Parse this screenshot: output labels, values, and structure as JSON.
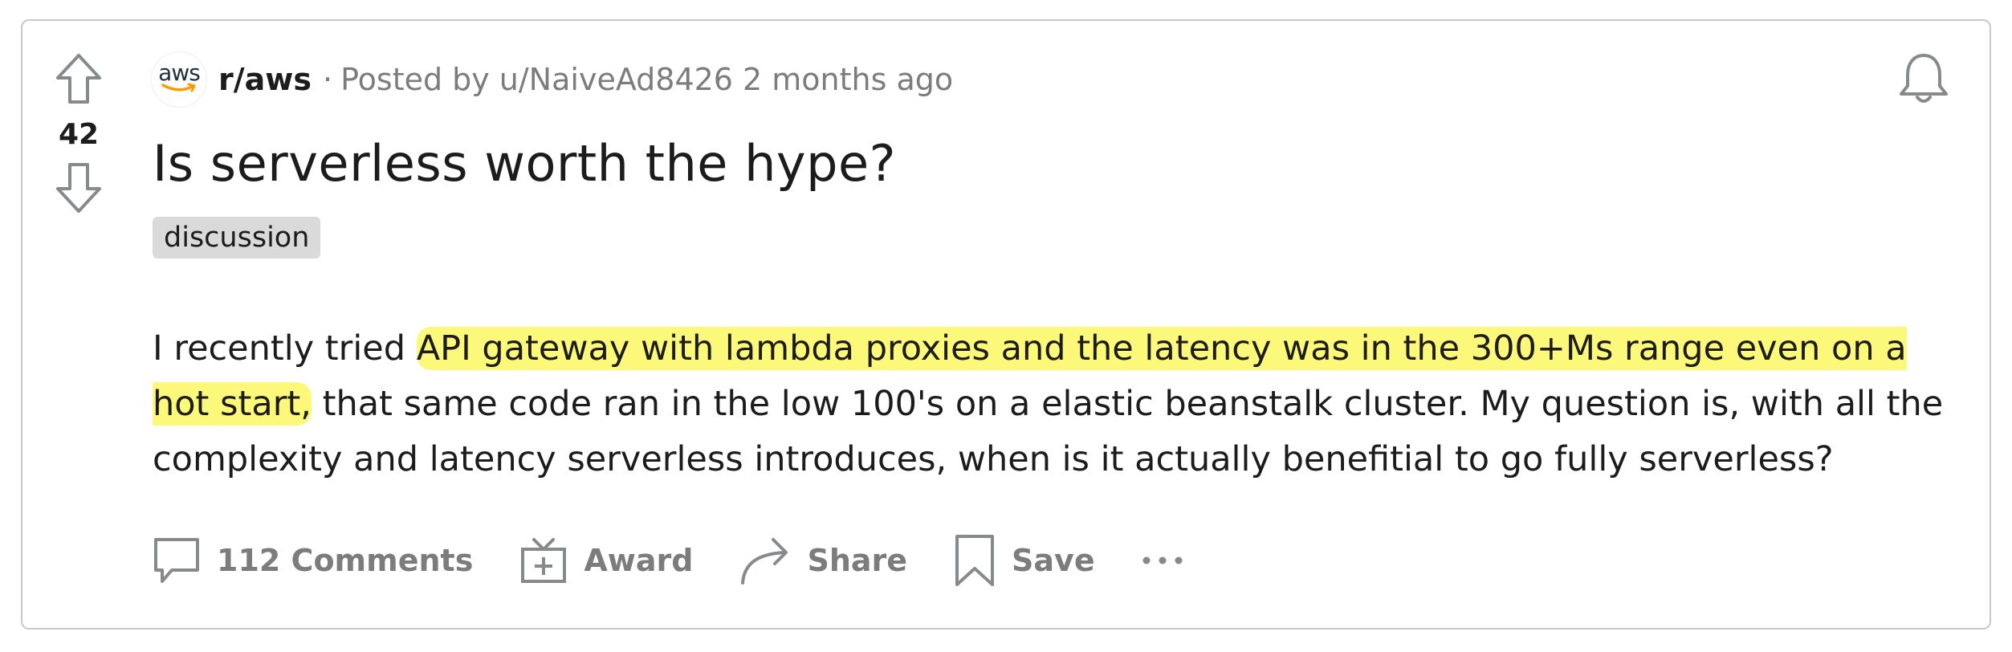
{
  "post": {
    "subreddit": "r/aws",
    "subreddit_icon_text": "aws",
    "posted_by_prefix": "Posted by",
    "author": "u/NaiveAd8426",
    "time_ago": "2 months ago",
    "separator": "·",
    "score": "42",
    "title": "Is serverless worth the hype?",
    "flair": "discussion",
    "body": {
      "before_highlight": "I recently tried ",
      "highlight": "API gateway with lambda proxies and the latency was in the 300+Ms range even on a hot start,",
      "after_highlight": " that same code ran in the low 100's on a elastic beanstalk cluster. My question is, with all the complexity and latency serverless introduces, when is it actually benefitial to go fully serverless?"
    },
    "highlight_color": "#fcf87a"
  },
  "actions": {
    "comments_label": "112 Comments",
    "award_label": "Award",
    "share_label": "Share",
    "save_label": "Save",
    "more_label": "···"
  },
  "icons": {
    "upvote": "arrow-up-icon",
    "downvote": "arrow-down-icon",
    "notification": "bell-icon",
    "comment": "comment-icon",
    "award": "gift-icon",
    "share": "share-arrow-icon",
    "save": "bookmark-icon",
    "more": "ellipsis-icon"
  },
  "colors": {
    "text_primary": "#1c1c1c",
    "text_muted": "#7c7c7c",
    "flair_bg": "#dadada",
    "aws_orange": "#ff9900",
    "border": "#c9c9c9"
  }
}
